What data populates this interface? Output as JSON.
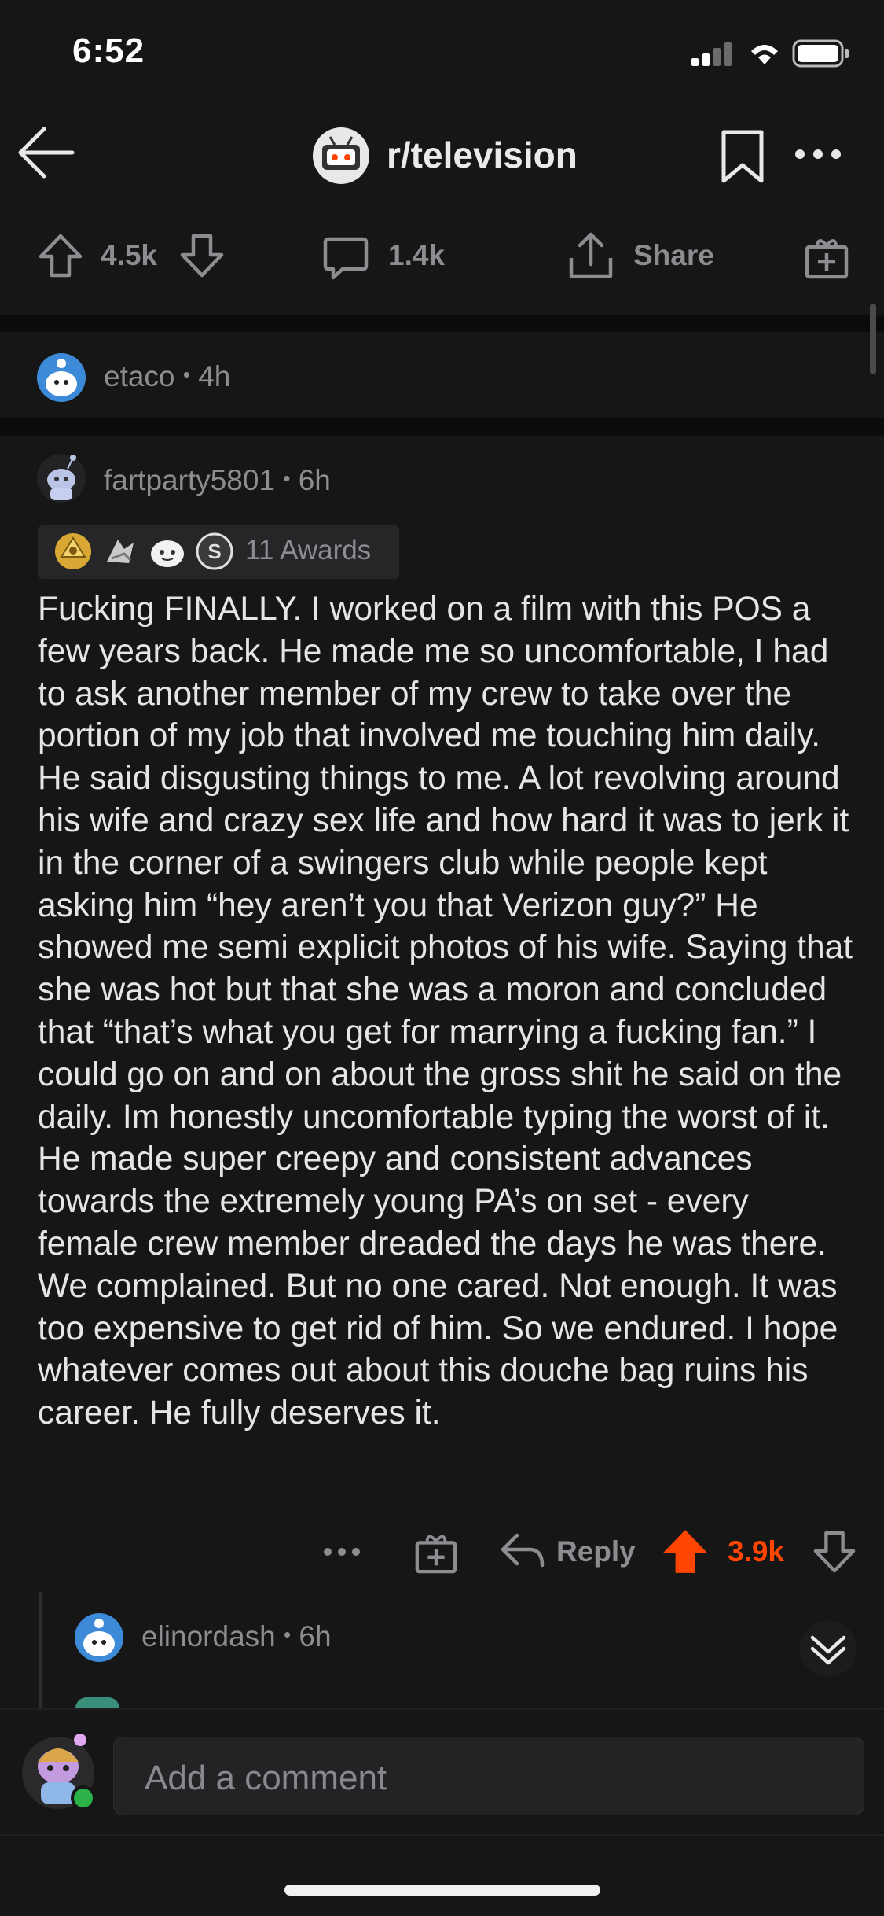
{
  "status_bar": {
    "time": "6:52"
  },
  "header": {
    "subreddit": "r/television"
  },
  "post_actions": {
    "upvotes": "4.5k",
    "comments": "1.4k",
    "share_label": "Share"
  },
  "collapsed_comment": {
    "username": "etaco",
    "separator": "•",
    "age": "4h"
  },
  "comment": {
    "username": "fartparty5801",
    "separator": "•",
    "age": "6h",
    "awards_label": "11 Awards",
    "body": "Fucking FINALLY. I worked on a film with this POS a few years back. He made me so uncomfortable, I had to ask another member of my crew to take over the portion of my job that involved me touching him daily. He said disgusting things to me. A lot revolving around his wife and crazy sex life and how hard it was to jerk it in the corner of a swingers club while people kept asking him “hey aren’t you that Verizon guy?” He showed me semi explicit photos of his wife. Saying that she was hot but that she was a moron and concluded that “that’s what you get for marrying a fucking fan.” I could go on and on about the gross shit he said on the daily. Im honestly uncomfortable typing the worst of it. He made super creepy and consistent advances towards the extremely young PA’s on set - every female crew member dreaded the days he was there. We complained. But no one cared. Not enough. It was too expensive to get rid of him. So we endured. I hope whatever comes out about this douche bag ruins his career. He fully deserves it.",
    "reply_label": "Reply",
    "score": "3.9k"
  },
  "reply": {
    "username": "elinordash",
    "separator": "•",
    "age": "6h"
  },
  "composer": {
    "placeholder": "Add a comment"
  },
  "colors": {
    "background": "#161617",
    "upvote_accent": "#ff4500",
    "muted_text": "#8b8d90"
  },
  "icons": [
    "back-arrow-icon",
    "snoo-subreddit-icon",
    "bookmark-icon",
    "more-icon",
    "upvote-icon",
    "downvote-icon",
    "comment-bubble-icon",
    "share-icon",
    "gift-icon",
    "reply-arrow-icon",
    "collapse-chevron-icon"
  ]
}
